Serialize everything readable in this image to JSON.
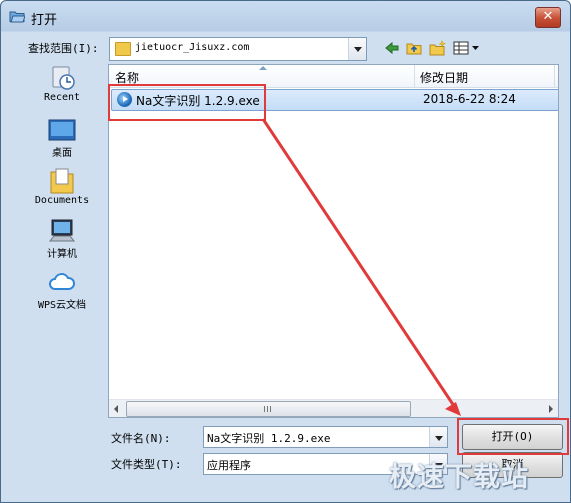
{
  "window": {
    "title": "打开",
    "close_label": "✕"
  },
  "look_in": {
    "label": "查找范围(I):",
    "value": "jietuocr_Jisuxz.com"
  },
  "toolbar": {
    "icons": [
      "back-arrow-icon",
      "up-folder-icon",
      "new-folder-icon",
      "view-menu-icon"
    ]
  },
  "places": [
    {
      "label": "Recent",
      "icon": "recent-icon"
    },
    {
      "label": "桌面",
      "icon": "desktop-icon"
    },
    {
      "label": "Documents",
      "icon": "documents-icon"
    },
    {
      "label": "计算机",
      "icon": "computer-icon"
    },
    {
      "label": "WPS云文档",
      "icon": "cloud-icon"
    }
  ],
  "file_list": {
    "columns": [
      "名称",
      "修改日期"
    ],
    "rows": [
      {
        "name": "Na文字识别 1.2.9.exe",
        "date": "2018-6-22 8:24"
      }
    ],
    "scroll_grip": "III"
  },
  "filename": {
    "label": "文件名(N):",
    "value": "Na文字识别 1.2.9.exe"
  },
  "filetype": {
    "label": "文件类型(T):",
    "value": "应用程序"
  },
  "buttons": {
    "open": "打开(O)",
    "cancel": "取消"
  },
  "watermark": "极速下载站",
  "colors": {
    "highlight_red": "#e03a3a",
    "selection": "#c3dcf6"
  }
}
